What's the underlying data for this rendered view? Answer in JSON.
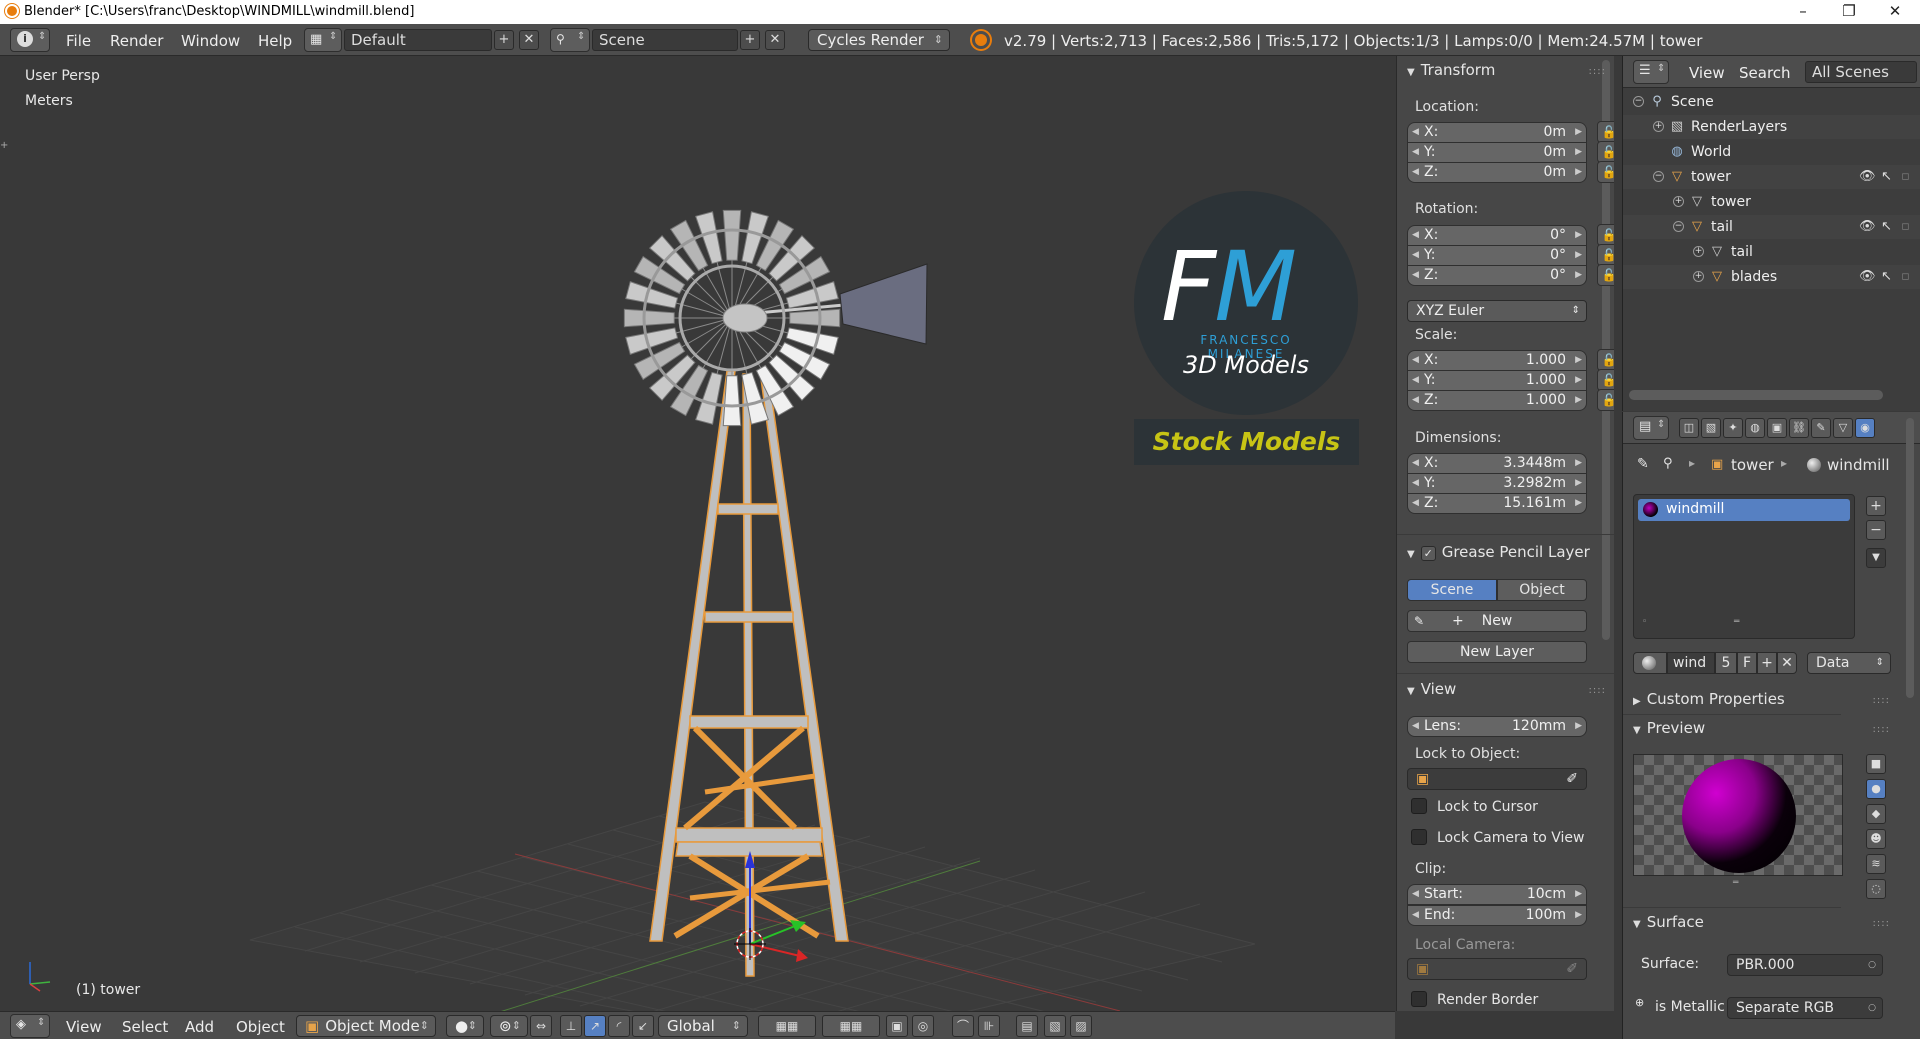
{
  "window": {
    "title": "Blender* [C:\\Users\\franc\\Desktop\\WINDMILL\\windmill.blend]",
    "minimize": "–",
    "maximize": "❐",
    "close": "✕"
  },
  "info_header": {
    "menus": [
      "File",
      "Render",
      "Window",
      "Help"
    ],
    "screen_layout": "Default",
    "scene": "Scene",
    "render_engine": "Cycles Render",
    "stats": "v2.79 | Verts:2,713 | Faces:2,586 | Tris:5,172 | Objects:1/3 | Lamps:0/0 | Mem:24.57M | tower"
  },
  "viewport": {
    "view_name": "User Persp",
    "units": "Meters",
    "active_object": "(1) tower",
    "logo": {
      "initials_f": "F",
      "initials_m": "M",
      "name": "FRANCESCO MILANESE",
      "subtitle": "3D Models",
      "banner": "Stock Models"
    }
  },
  "npanel": {
    "transform": {
      "header": "Transform",
      "location_label": "Location:",
      "location": [
        {
          "axis": "X:",
          "value": "0m"
        },
        {
          "axis": "Y:",
          "value": "0m"
        },
        {
          "axis": "Z:",
          "value": "0m"
        }
      ],
      "rotation_label": "Rotation:",
      "rotation": [
        {
          "axis": "X:",
          "value": "0°"
        },
        {
          "axis": "Y:",
          "value": "0°"
        },
        {
          "axis": "Z:",
          "value": "0°"
        }
      ],
      "rotation_mode": "XYZ Euler",
      "scale_label": "Scale:",
      "scale": [
        {
          "axis": "X:",
          "value": "1.000"
        },
        {
          "axis": "Y:",
          "value": "1.000"
        },
        {
          "axis": "Z:",
          "value": "1.000"
        }
      ],
      "dimensions_label": "Dimensions:",
      "dimensions": [
        {
          "axis": "X:",
          "value": "3.3448m"
        },
        {
          "axis": "Y:",
          "value": "3.2982m"
        },
        {
          "axis": "Z:",
          "value": "15.161m"
        }
      ]
    },
    "grease_pencil": {
      "header": "Grease Pencil Layer",
      "tab_scene": "Scene",
      "tab_object": "Object",
      "new": "New",
      "new_layer": "New Layer"
    },
    "view": {
      "header": "View",
      "lens_label": "Lens:",
      "lens_value": "120mm",
      "lock_to_object": "Lock to Object:",
      "lock_to_cursor": "Lock to Cursor",
      "lock_camera": "Lock Camera to View",
      "clip": "Clip:",
      "start_label": "Start:",
      "start_value": "10cm",
      "end_label": "End:",
      "end_value": "100m",
      "local_camera": "Local Camera:",
      "render_border": "Render Border"
    }
  },
  "outliner": {
    "menus": [
      "View",
      "Search"
    ],
    "display_mode": "All Scenes",
    "items": [
      {
        "name": "Scene"
      },
      {
        "name": "RenderLayers"
      },
      {
        "name": "World"
      },
      {
        "name": "tower"
      },
      {
        "name": "tower"
      },
      {
        "name": "tail"
      },
      {
        "name": "tail"
      },
      {
        "name": "blades"
      }
    ]
  },
  "properties": {
    "breadcrumb_object": "tower",
    "breadcrumb_material": "windmill",
    "material_slot": "windmill",
    "datablock_name": "wind",
    "users": "5",
    "fake_user": "F",
    "link": "Data",
    "custom_properties": "Custom Properties",
    "preview": "Preview",
    "surface_header": "Surface",
    "surface_label": "Surface:",
    "surface_value": "PBR.000",
    "is_metallic_label": "is Metallic",
    "is_metallic_value": "Separate RGB"
  },
  "bottom_header": {
    "menus": [
      "View",
      "Select",
      "Add",
      "Object"
    ],
    "mode": "Object Mode",
    "orientation": "Global"
  },
  "colors": {
    "accent_blue": "#5680c2",
    "brand_blue": "#2e9fd6",
    "banner_yellow": "#c7c415",
    "selection_orange": "#e89a3c"
  }
}
